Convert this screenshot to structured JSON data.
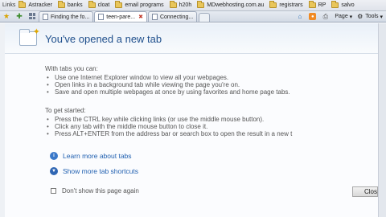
{
  "links_bar": {
    "label": "Links",
    "items": [
      "Astracker",
      "banks",
      "cloat",
      "email programs",
      "h20h",
      "MDwebhosting.com.au",
      "registrars",
      "RP",
      "salvo"
    ]
  },
  "tabs": {
    "items": [
      {
        "label": "Finding the fo...",
        "active": false
      },
      {
        "label": "teen-pare...",
        "active": true
      },
      {
        "label": "Connecting...",
        "active": false
      }
    ]
  },
  "command_bar": {
    "page_label": "Page",
    "tools_label": "Tools"
  },
  "page": {
    "title": "You've opened a new tab",
    "with_tabs": {
      "heading": "With tabs you can:",
      "items": [
        "Use one Internet Explorer window to view all your webpages.",
        "Open links in a background tab while viewing the page you're on.",
        "Save and open multiple webpages at once by using favorites and home page tabs."
      ]
    },
    "get_started": {
      "heading": "To get started:",
      "items": [
        "Press the CTRL key while clicking links (or use the middle mouse button).",
        "Click any tab with the middle mouse button to close it.",
        "Press ALT+ENTER from the address bar or search box to open the result in a new t"
      ]
    },
    "learn_more": "Learn more about tabs",
    "show_shortcuts": "Show more tab shortcuts",
    "dont_show": "Don't show this page again",
    "close_label": "Clos"
  }
}
